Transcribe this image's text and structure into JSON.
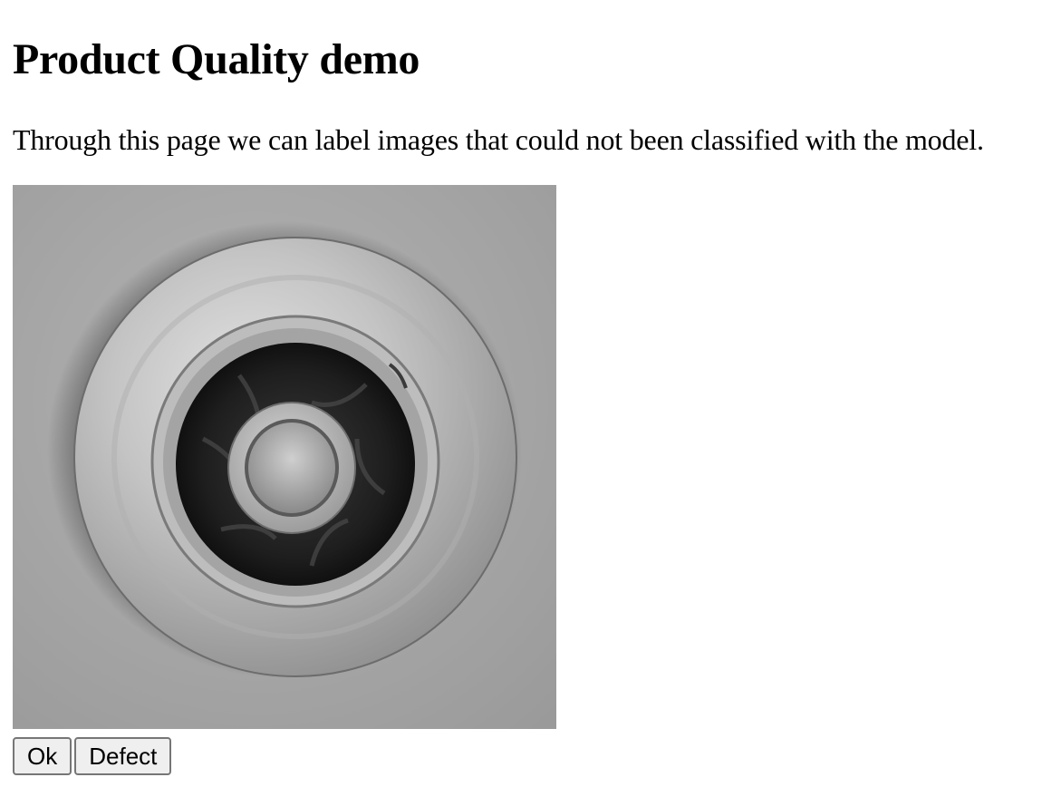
{
  "page": {
    "title": "Product Quality demo",
    "intro": "Through this page we can label images that could not been classified with the model."
  },
  "image": {
    "subject": "grayscale photo of a cast metal impeller part, top view"
  },
  "actions": {
    "ok_label": "Ok",
    "defect_label": "Defect"
  }
}
